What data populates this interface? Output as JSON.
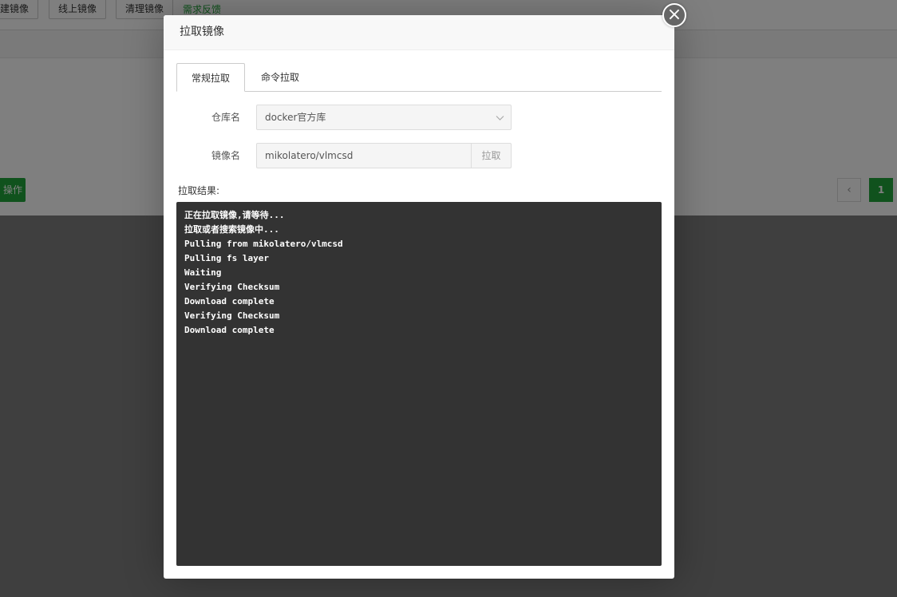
{
  "background": {
    "toolbar": {
      "buttons": [
        "建镜像",
        "线上镜像",
        "清理镜像"
      ],
      "feedback_link": "需求反馈"
    },
    "action_button": "操作",
    "pagination": {
      "prev": "‹",
      "current_page": "1"
    }
  },
  "modal": {
    "title": "拉取镜像",
    "close_icon": "×",
    "tabs": [
      "常规拉取",
      "命令拉取"
    ],
    "active_tab": "常规拉取",
    "form": {
      "repo_label": "仓库名",
      "repo_value": "docker官方库",
      "image_label": "镜像名",
      "image_value": "mikolatero/vlmcsd",
      "pull_button": "拉取"
    },
    "result_label": "拉取结果:",
    "console_lines": [
      "正在拉取镜像,请等待...",
      "拉取或者搜索镜像中...",
      "Pulling from mikolatero/vlmcsd",
      "Pulling fs layer",
      "Waiting",
      "Verifying Checksum",
      "Download complete",
      "Verifying Checksum",
      "Download complete"
    ]
  },
  "colors": {
    "accent_green": "#20a53a",
    "console_bg": "#333333",
    "overlay": "rgba(0,0,0,0.5)"
  }
}
